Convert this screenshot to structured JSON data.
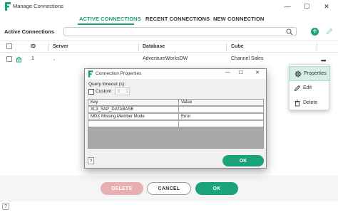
{
  "window": {
    "title": "Manage Connections",
    "minimize": "—",
    "maximize": "☐",
    "close": "✕"
  },
  "tabs": [
    {
      "label": "ACTIVE CONNECTIONS",
      "active": true
    },
    {
      "label": "RECENT CONNECTIONS",
      "active": false
    },
    {
      "label": "NEW CONNECTION",
      "active": false
    }
  ],
  "toolbar": {
    "section_label": "Active Connections",
    "search_value": "",
    "add_label": "+"
  },
  "grid": {
    "columns": [
      "ID",
      "Server",
      "Database",
      "Cube"
    ],
    "rows": [
      {
        "id": "1",
        "server": ",",
        "database": "AdventureWorksDW",
        "cube": "Channel Sales"
      }
    ],
    "more_label": "•••"
  },
  "context_menu": {
    "items": [
      {
        "label": "Properties",
        "icon": "gear-icon",
        "selected": true
      },
      {
        "label": "Edit",
        "icon": "pencil-icon",
        "selected": false
      },
      {
        "label": "Delete",
        "icon": "trash-icon",
        "selected": false
      }
    ]
  },
  "dialog": {
    "title": "Connection Properties",
    "minimize": "—",
    "maximize": "☐",
    "close": "✕",
    "timeout_label": "Query timeout (s):",
    "custom_label": "Custom",
    "custom_checked": false,
    "timeout_value": "0",
    "grid_headers": [
      "Key",
      "Value"
    ],
    "grid_rows": [
      {
        "key": "XL3_SAP_DATABASE",
        "value": ""
      },
      {
        "key": "MDX Missing Member Mode",
        "value": "Error"
      },
      {
        "key": "",
        "value": ""
      }
    ],
    "help_label": "?",
    "ok_label": "OK"
  },
  "footer": {
    "delete_label": "DELETE",
    "cancel_label": "CANCEL",
    "ok_label": "OK",
    "help_label": "?"
  },
  "colors": {
    "accent": "#1aa37a",
    "delete_disabled": "#e8aeb0"
  }
}
